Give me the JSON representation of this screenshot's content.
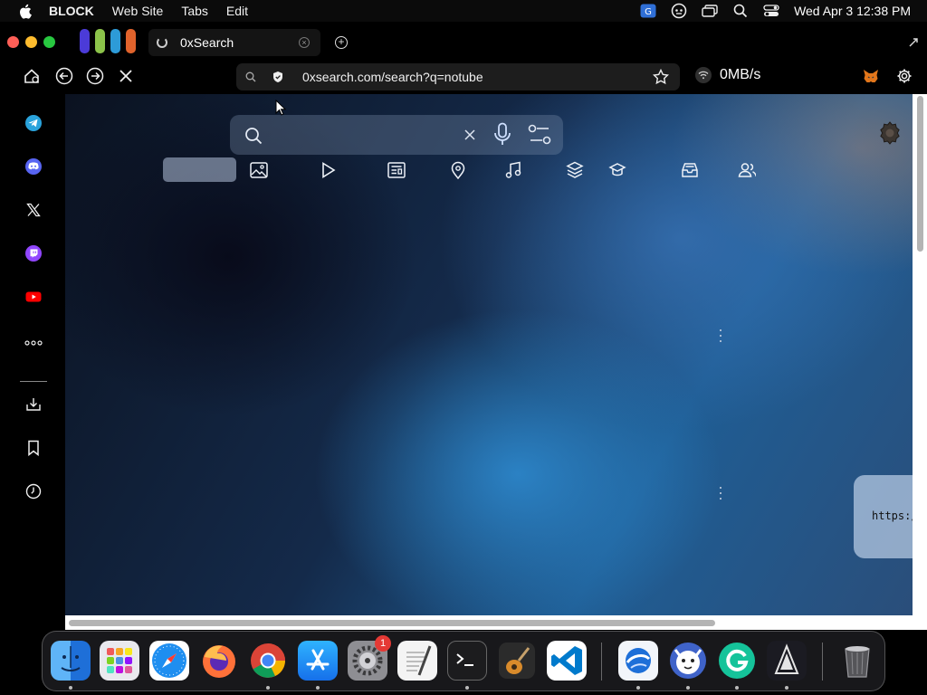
{
  "menubar": {
    "app_name": "BLOCK",
    "menus": [
      "Web Site",
      "Tabs",
      "Edit"
    ],
    "datetime": "Wed Apr 3  12:38 PM"
  },
  "tabs": {
    "active_title": "0xSearch"
  },
  "toolbar": {
    "url": "0xsearch.com/search?q=notube",
    "speed": "0MB/s"
  },
  "search": {
    "query": ""
  },
  "content": {
    "side_card_text": "https:/"
  },
  "dock": {
    "settings_badge": "1"
  },
  "colors": {
    "traffic_close": "#ff5f57",
    "traffic_min": "#febc2e",
    "traffic_max": "#28c840",
    "space_1": "#4b3bd8",
    "space_2": "#8cc34a",
    "space_3": "#2d9bd8",
    "space_4": "#e0632c"
  }
}
